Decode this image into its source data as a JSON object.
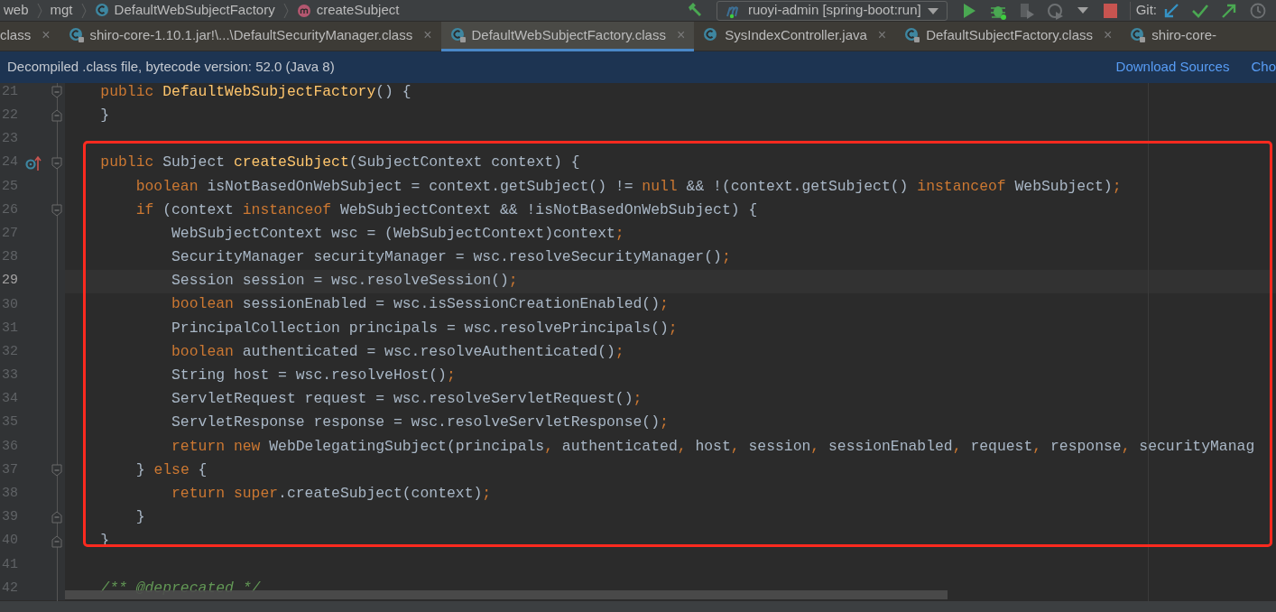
{
  "breadcrumb": [
    {
      "label": "web",
      "kind": "plain"
    },
    {
      "label": "mgt",
      "kind": "plain"
    },
    {
      "label": "DefaultWebSubjectFactory",
      "kind": "class"
    },
    {
      "label": "createSubject",
      "kind": "method"
    }
  ],
  "toolbar": {
    "run_config": "ruoyi-admin [spring-boot:run]",
    "git_label": "Git:"
  },
  "tabs": [
    {
      "label": "class",
      "kind": "cut",
      "selected": false,
      "close": "×"
    },
    {
      "label": "shiro-core-1.10.1.jar!\\...\\DefaultSecurityManager.class",
      "kind": "class",
      "locked": true,
      "selected": false,
      "close": "×"
    },
    {
      "label": "DefaultWebSubjectFactory.class",
      "kind": "class",
      "locked": true,
      "selected": true,
      "close": "×"
    },
    {
      "label": "SysIndexController.java",
      "kind": "class",
      "locked": false,
      "selected": false,
      "close": "×"
    },
    {
      "label": "DefaultSubjectFactory.class",
      "kind": "class",
      "locked": true,
      "selected": false,
      "close": "×"
    },
    {
      "label": "shiro-core-",
      "kind": "class",
      "locked": true,
      "selected": false
    }
  ],
  "banner": {
    "text": "Decompiled .class file, bytecode version: 52.0 (Java 8)",
    "links": [
      "Download Sources",
      "Cho"
    ]
  },
  "editor": {
    "lines": [
      {
        "number": "21",
        "fold": {
          "kind": "start"
        },
        "current": false,
        "tokens": [
          {
            "kind": "keyword",
            "text": "    public "
          },
          {
            "kind": "declaration",
            "text": "DefaultWebSubjectFactory"
          },
          {
            "kind": "plain",
            "text": "() {"
          }
        ]
      },
      {
        "number": "22",
        "fold": {
          "kind": "end"
        },
        "current": false,
        "tokens": [
          {
            "kind": "plain",
            "text": "    }"
          }
        ]
      },
      {
        "number": "23",
        "current": false
      },
      {
        "number": "24",
        "fold": {
          "kind": "start"
        },
        "gutter_icon": {
          "kind": "override"
        },
        "current": false,
        "tokens": [
          {
            "kind": "keyword",
            "text": "    public "
          },
          {
            "kind": "plain",
            "text": "Subject "
          },
          {
            "kind": "declaration",
            "text": "createSubject"
          },
          {
            "kind": "plain",
            "text": "(SubjectContext context) {"
          }
        ]
      },
      {
        "number": "25",
        "current": false,
        "tokens": [
          {
            "kind": "keyword",
            "text": "        boolean "
          },
          {
            "kind": "plain",
            "text": "isNotBasedOnWebSubject = context.getSubject() != "
          },
          {
            "kind": "keyword",
            "text": "null "
          },
          {
            "kind": "plain",
            "text": "&& !(context.getSubject() "
          },
          {
            "kind": "keyword",
            "text": "instanceof "
          },
          {
            "kind": "plain",
            "text": "WebSubject)"
          },
          {
            "kind": "keyword",
            "text": ";"
          }
        ]
      },
      {
        "number": "26",
        "fold": {
          "kind": "start"
        },
        "current": false,
        "tokens": [
          {
            "kind": "keyword",
            "text": "        if "
          },
          {
            "kind": "plain",
            "text": "(context "
          },
          {
            "kind": "keyword",
            "text": "instanceof "
          },
          {
            "kind": "plain",
            "text": "WebSubjectContext && !isNotBasedOnWebSubject) {"
          }
        ]
      },
      {
        "number": "27",
        "current": false,
        "tokens": [
          {
            "kind": "plain",
            "text": "            WebSubjectContext wsc = (WebSubjectContext)context"
          },
          {
            "kind": "keyword",
            "text": ";"
          }
        ]
      },
      {
        "number": "28",
        "current": false,
        "tokens": [
          {
            "kind": "plain",
            "text": "            SecurityManager securityManager = wsc.resolveSecurityManager()"
          },
          {
            "kind": "keyword",
            "text": ";"
          }
        ]
      },
      {
        "number": "29",
        "current": true,
        "tokens": [
          {
            "kind": "plain",
            "text": "            Session session = wsc.resolveSession()"
          },
          {
            "kind": "keyword",
            "text": ";"
          }
        ]
      },
      {
        "number": "30",
        "current": false,
        "tokens": [
          {
            "kind": "keyword",
            "text": "            boolean "
          },
          {
            "kind": "plain",
            "text": "sessionEnabled = wsc.isSessionCreationEnabled()"
          },
          {
            "kind": "keyword",
            "text": ";"
          }
        ]
      },
      {
        "number": "31",
        "current": false,
        "tokens": [
          {
            "kind": "plain",
            "text": "            PrincipalCollection principals = wsc.resolvePrincipals()"
          },
          {
            "kind": "keyword",
            "text": ";"
          }
        ]
      },
      {
        "number": "32",
        "current": false,
        "tokens": [
          {
            "kind": "keyword",
            "text": "            boolean "
          },
          {
            "kind": "plain",
            "text": "authenticated = wsc.resolveAuthenticated()"
          },
          {
            "kind": "keyword",
            "text": ";"
          }
        ]
      },
      {
        "number": "33",
        "current": false,
        "tokens": [
          {
            "kind": "plain",
            "text": "            String host = wsc.resolveHost()"
          },
          {
            "kind": "keyword",
            "text": ";"
          }
        ]
      },
      {
        "number": "34",
        "current": false,
        "tokens": [
          {
            "kind": "plain",
            "text": "            ServletRequest request = wsc.resolveServletRequest()"
          },
          {
            "kind": "keyword",
            "text": ";"
          }
        ]
      },
      {
        "number": "35",
        "current": false,
        "tokens": [
          {
            "kind": "plain",
            "text": "            ServletResponse response = wsc.resolveServletResponse()"
          },
          {
            "kind": "keyword",
            "text": ";"
          }
        ]
      },
      {
        "number": "36",
        "current": false,
        "tokens": [
          {
            "kind": "keyword",
            "text": "            return new "
          },
          {
            "kind": "plain",
            "text": "WebDelegatingSubject(principals"
          },
          {
            "kind": "keyword",
            "text": ", "
          },
          {
            "kind": "plain",
            "text": "authenticated"
          },
          {
            "kind": "keyword",
            "text": ", "
          },
          {
            "kind": "plain",
            "text": "host"
          },
          {
            "kind": "keyword",
            "text": ", "
          },
          {
            "kind": "plain",
            "text": "session"
          },
          {
            "kind": "keyword",
            "text": ", "
          },
          {
            "kind": "plain",
            "text": "sessionEnabled"
          },
          {
            "kind": "keyword",
            "text": ", "
          },
          {
            "kind": "plain",
            "text": "request"
          },
          {
            "kind": "keyword",
            "text": ", "
          },
          {
            "kind": "plain",
            "text": "response"
          },
          {
            "kind": "keyword",
            "text": ", "
          },
          {
            "kind": "plain",
            "text": "securityManag"
          }
        ]
      },
      {
        "number": "37",
        "fold": {
          "kind": "start"
        },
        "current": false,
        "tokens": [
          {
            "kind": "plain",
            "text": "        } "
          },
          {
            "kind": "keyword",
            "text": "else "
          },
          {
            "kind": "plain",
            "text": "{"
          }
        ]
      },
      {
        "number": "38",
        "current": false,
        "tokens": [
          {
            "kind": "keyword",
            "text": "            return super"
          },
          {
            "kind": "plain",
            "text": ".createSubject(context)"
          },
          {
            "kind": "keyword",
            "text": ";"
          }
        ]
      },
      {
        "number": "39",
        "fold": {
          "kind": "end"
        },
        "current": false,
        "tokens": [
          {
            "kind": "plain",
            "text": "        }"
          }
        ]
      },
      {
        "number": "40",
        "fold": {
          "kind": "end"
        },
        "current": false,
        "tokens": [
          {
            "kind": "plain",
            "text": "    }"
          }
        ]
      },
      {
        "number": "41",
        "current": false
      },
      {
        "number": "42",
        "current": false,
        "tokens": [
          {
            "kind": "comment",
            "text": "    /** @deprecated */"
          }
        ]
      }
    ]
  }
}
